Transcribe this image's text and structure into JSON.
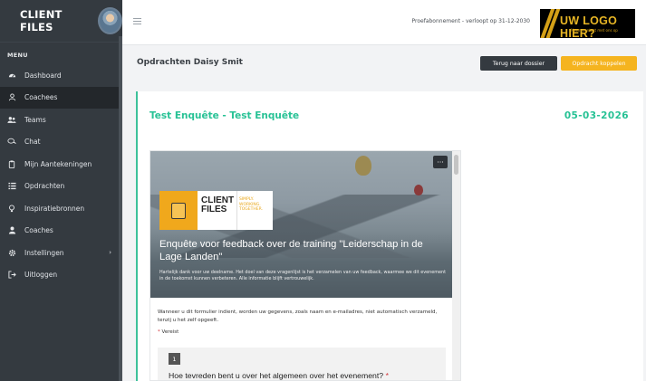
{
  "sidebar": {
    "brand": "CLIENT FILES",
    "menu_title": "MENU",
    "items": [
      {
        "label": "Dashboard",
        "icon": "dashboard-icon",
        "active": false
      },
      {
        "label": "Coachees",
        "icon": "user-icon",
        "active": true
      },
      {
        "label": "Teams",
        "icon": "users-icon",
        "active": false
      },
      {
        "label": "Chat",
        "icon": "chat-icon",
        "active": false
      },
      {
        "label": "Mijn Aantekeningen",
        "icon": "clipboard-icon",
        "active": false
      },
      {
        "label": "Opdrachten",
        "icon": "list-icon",
        "active": false
      },
      {
        "label": "Inspiratiebronnen",
        "icon": "lightbulb-icon",
        "active": false
      },
      {
        "label": "Coaches",
        "icon": "user-tie-icon",
        "active": false
      },
      {
        "label": "Instellingen",
        "icon": "gear-icon",
        "active": false,
        "has_submenu": true
      },
      {
        "label": "Uitloggen",
        "icon": "logout-icon",
        "active": false
      }
    ]
  },
  "topbar": {
    "trial_text": "Proefabonnement - verloopt op 31-12-2030",
    "logo_text": "UW LOGO HIER?",
    "logo_subtext": "Neem contact met ons op"
  },
  "subheader": {
    "title": "Opdrachten Daisy Smit",
    "back_button": "Terug naar dossier",
    "link_button": "Opdracht koppelen"
  },
  "card": {
    "title": "Test Enquête - Test Enquête",
    "date": "05-03-2026"
  },
  "form": {
    "brand_word_1": "CLIENT",
    "brand_word_2": "FILES",
    "tagline_1": "SIMPLY.",
    "tagline_2": "WORKING.",
    "tagline_3": "TOGETHER.",
    "more_label": "···",
    "title": "Enquête voor feedback over de training \"Leiderschap in de Lage Landen\"",
    "description": "Hartelijk dank voor uw deelname. Het doel van deze vragenlijst is het verzamelen van uw feedback, waarmee we dit evenement in de toekomst kunnen verbeteren. Alle informatie blijft vertrouwelijk.",
    "notice": "Wanneer u dit formulier indient, worden uw gegevens, zoals naam en e-mailadres, niet automatisch verzameld, tenzij u het zelf opgeeft.",
    "required_star": "*",
    "required_label": "Vereist",
    "question_number": "1",
    "question_text": "Hoe tevreden bent u over het algemeen over het evenement?"
  },
  "colors": {
    "sidebar_bg": "#343a40",
    "accent_green": "#27c295",
    "accent_yellow": "#f5b41f",
    "dark_button": "#343a40"
  }
}
